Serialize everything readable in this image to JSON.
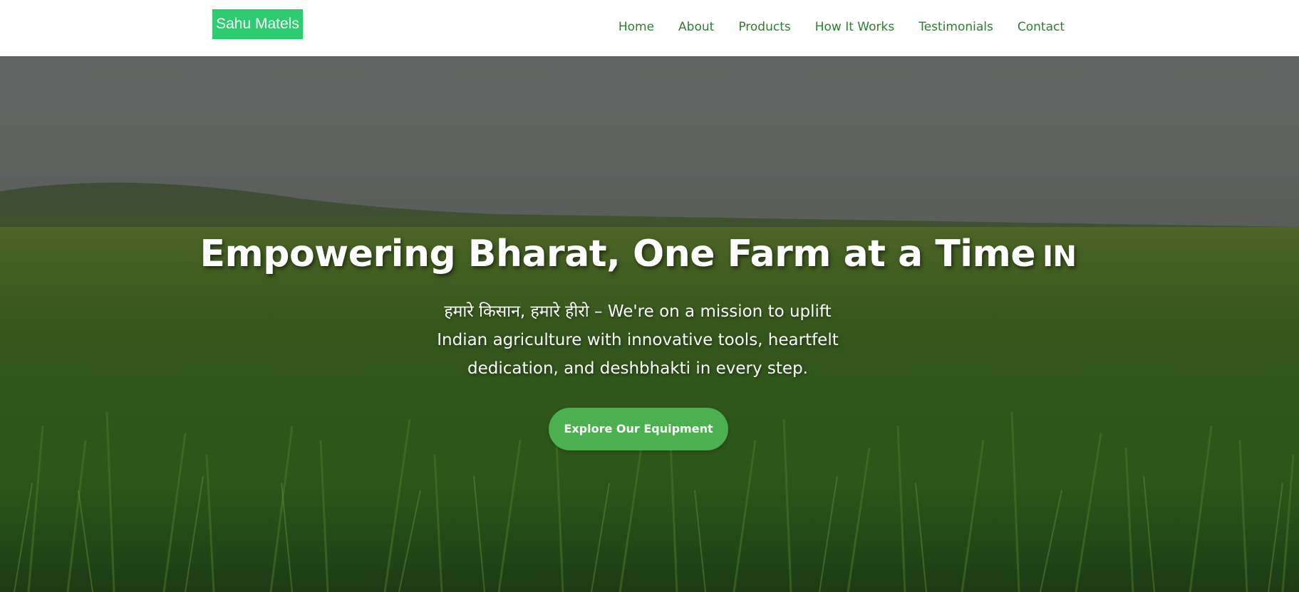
{
  "brand": {
    "logo_text": "Sahu Matels",
    "accent_color": "#2ecc71"
  },
  "nav": {
    "items": [
      {
        "label": "Home"
      },
      {
        "label": "About"
      },
      {
        "label": "Products"
      },
      {
        "label": "How It Works"
      },
      {
        "label": "Testimonials"
      },
      {
        "label": "Contact"
      }
    ],
    "link_color": "#2e7d32"
  },
  "hero": {
    "title": "Empowering Bharat, One Farm at a Time",
    "title_flag": "IN",
    "subtitle": "हमारे किसान, हमारे हीरो – We're on a mission to uplift Indian agriculture with innovative tools, heartfelt dedication, and deshbhakti in every step.",
    "cta_label": "Explore Our Equipment",
    "cta_color": "#4caf50"
  }
}
